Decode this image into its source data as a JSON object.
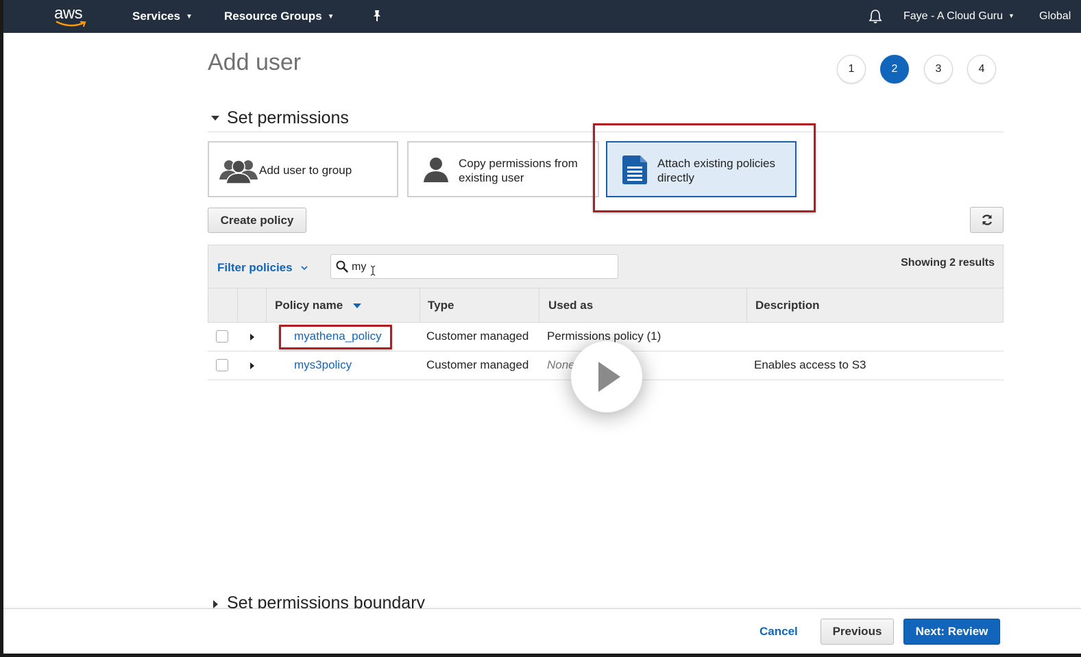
{
  "nav": {
    "logo_text": "aws",
    "services_label": "Services",
    "resource_groups_label": "Resource Groups",
    "user_label": "Faye - A Cloud Guru",
    "region_label": "Global",
    "icons": {
      "pin": "pin-icon",
      "bell": "bell-icon",
      "caret": "caret-down-icon"
    }
  },
  "page": {
    "title": "Add user",
    "steps": [
      "1",
      "2",
      "3",
      "4"
    ],
    "active_step": "2"
  },
  "permissions": {
    "section_title": "Set permissions",
    "options": {
      "add_to_group": "Add user to group",
      "copy_line1": "Copy permissions from",
      "copy_line2": "existing user",
      "attach_line1": "Attach existing policies",
      "attach_line2": "directly"
    },
    "selected_option": "Attach existing policies directly",
    "create_policy_label": "Create policy",
    "filter_label": "Filter policies",
    "search_value": "my",
    "results_text": "Showing 2 results",
    "table": {
      "headers": {
        "policy_name": "Policy name",
        "type": "Type",
        "used_as": "Used as",
        "description": "Description"
      },
      "rows": [
        {
          "name": "myathena_policy",
          "type": "Customer managed",
          "used_as": "Permissions policy (1)",
          "description": ""
        },
        {
          "name": "mys3policy",
          "type": "Customer managed",
          "used_as": "None",
          "description": "Enables access to S3"
        }
      ]
    }
  },
  "boundary": {
    "section_title": "Set permissions boundary"
  },
  "footer": {
    "cancel_label": "Cancel",
    "previous_label": "Previous",
    "next_label": "Next: Review"
  },
  "colors": {
    "nav_bg": "#232f3e",
    "accent": "#1166bb",
    "highlight_red": "#b01e23",
    "selected_card_bg": "#deeaf6"
  }
}
